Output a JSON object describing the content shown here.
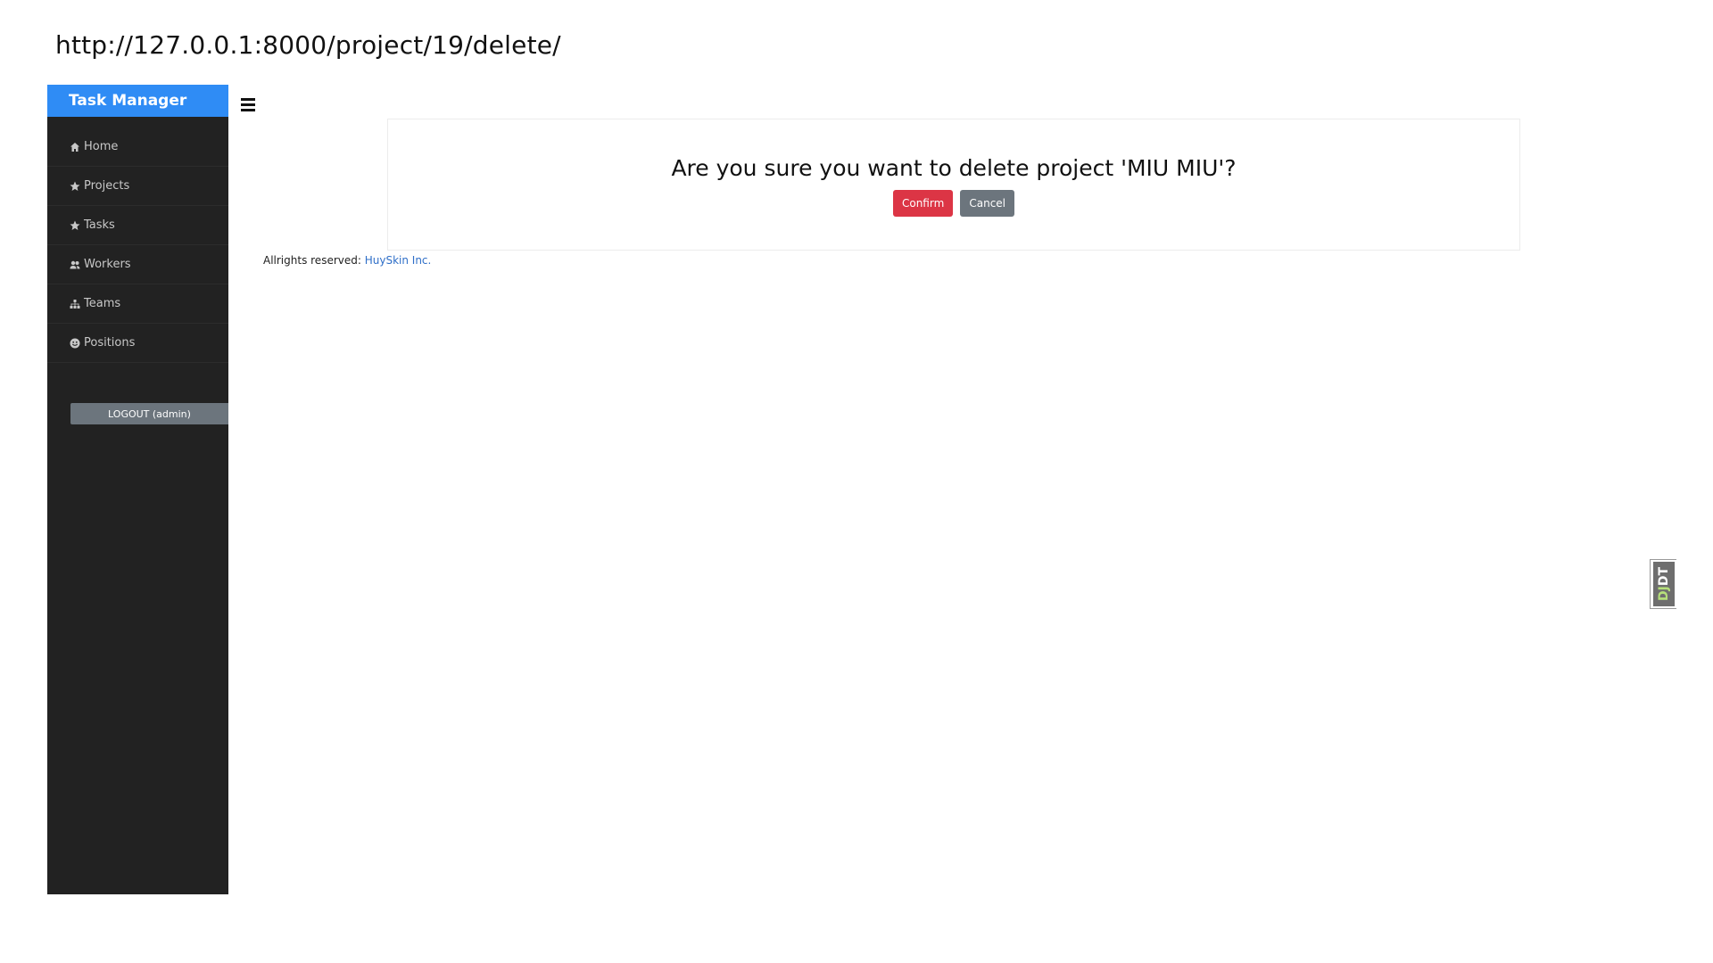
{
  "url": "http://127.0.0.1:8000/project/19/delete/",
  "sidebar": {
    "brand": "Task Manager",
    "items": [
      {
        "label": "Home",
        "icon": "home-icon"
      },
      {
        "label": "Projects",
        "icon": "star-icon"
      },
      {
        "label": "Tasks",
        "icon": "star-icon"
      },
      {
        "label": "Workers",
        "icon": "users-icon"
      },
      {
        "label": "Teams",
        "icon": "sitemap-icon"
      },
      {
        "label": "Positions",
        "icon": "smile-icon"
      }
    ],
    "logout_label": "LOGOUT (admin)"
  },
  "dialog": {
    "question": "Are you sure you want to delete project 'MIU MIU'?",
    "confirm_label": "Confirm",
    "cancel_label": "Cancel"
  },
  "footer": {
    "text": "Allrights reserved:",
    "link_text": "HuySkin Inc."
  },
  "debug_toolbar": {
    "label_dj": "DJ",
    "label_dt": "DT"
  },
  "colors": {
    "brand": "#2f8cf5",
    "sidebar_bg": "#222222",
    "danger": "#dc3545",
    "secondary": "#6c757d",
    "link": "#2f6fc8"
  }
}
